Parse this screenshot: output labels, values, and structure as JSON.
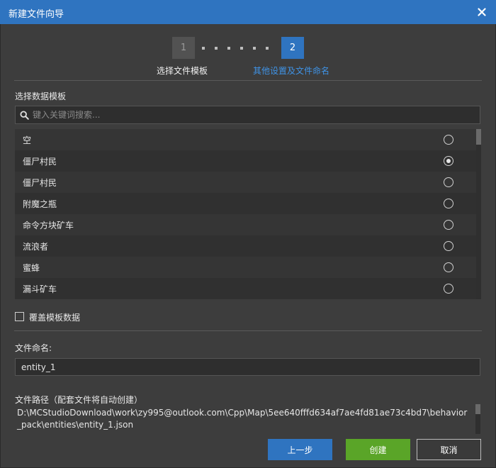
{
  "window": {
    "title": "新建文件向导"
  },
  "stepper": {
    "step1": {
      "number": "1",
      "label": "选择文件模板"
    },
    "step2": {
      "number": "2",
      "label": "其他设置及文件命名"
    }
  },
  "template": {
    "section_label": "选择数据模板",
    "search_placeholder": "键入关键词搜索...",
    "items": [
      {
        "name": "空",
        "selected": false
      },
      {
        "name": "僵尸村民",
        "selected": true
      },
      {
        "name": "僵尸村民",
        "selected": false
      },
      {
        "name": "附魔之瓶",
        "selected": false
      },
      {
        "name": "命令方块矿车",
        "selected": false
      },
      {
        "name": "流浪者",
        "selected": false
      },
      {
        "name": "蜜蜂",
        "selected": false
      },
      {
        "name": "漏斗矿车",
        "selected": false
      }
    ],
    "overwrite_label": "覆盖模板数据",
    "overwrite_checked": false
  },
  "file_name": {
    "label": "文件命名:",
    "value": "entity_1"
  },
  "file_path": {
    "label": "文件路径（配套文件将自动创建）",
    "value": "D:\\MCStudioDownload\\work\\zy995@outlook.com\\Cpp\\Map\\5ee640fffd634af7ae4fd81ae73c4bd7\\behavior_pack\\entities\\entity_1.json"
  },
  "buttons": {
    "prev": "上一步",
    "create": "创建",
    "cancel": "取消"
  },
  "colors": {
    "accent": "#2f74c0",
    "create": "#5aa528",
    "active_step_text": "#3f93e6"
  }
}
